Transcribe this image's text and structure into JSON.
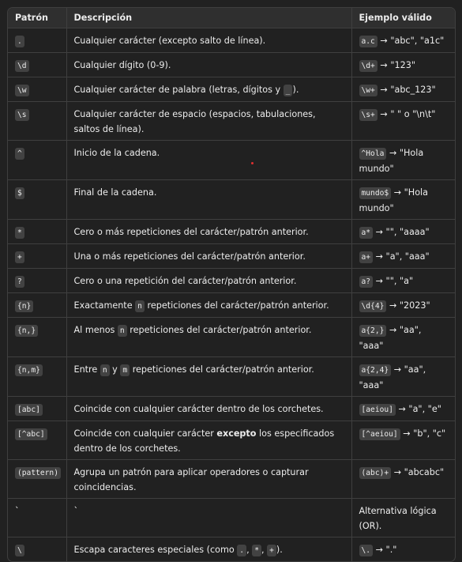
{
  "headers": [
    "Patrón",
    "Descripción",
    "Ejemplo válido"
  ],
  "rows": [
    {
      "pattern": ".",
      "desc": [
        "Cualquier carácter (excepto salto de línea)."
      ],
      "ex_code": "a.c",
      "ex_text": " → \"abc\", \"a1c\""
    },
    {
      "pattern": "\\d",
      "desc": [
        "Cualquier dígito (0-9)."
      ],
      "ex_code": "\\d+",
      "ex_text": " → \"123\""
    },
    {
      "pattern": "\\w",
      "desc": [
        "Cualquier carácter de palabra (letras, dígitos y ",
        {
          "code": "_"
        },
        ")."
      ],
      "ex_code": "\\w+",
      "ex_text": " → \"abc_123\""
    },
    {
      "pattern": "\\s",
      "desc": [
        "Cualquier carácter de espacio (espacios, tabulaciones, saltos de línea)."
      ],
      "ex_code": "\\s+",
      "ex_text": " → \" \" o \"\\n\\t\""
    },
    {
      "pattern": "^",
      "desc": [
        "Inicio de la cadena."
      ],
      "ex_code": "^Hola",
      "ex_text": " → \"Hola mundo\""
    },
    {
      "pattern": "$",
      "desc": [
        "Final de la cadena."
      ],
      "ex_code": "mundo$",
      "ex_text": " → \"Hola mundo\""
    },
    {
      "pattern": "*",
      "desc": [
        "Cero o más repeticiones del carácter/patrón anterior."
      ],
      "ex_code": "a*",
      "ex_text": " → \"\", \"aaaa\""
    },
    {
      "pattern": "+",
      "desc": [
        "Una o más repeticiones del carácter/patrón anterior."
      ],
      "ex_code": "a+",
      "ex_text": " → \"a\", \"aaa\""
    },
    {
      "pattern": "?",
      "desc": [
        "Cero o una repetición del carácter/patrón anterior."
      ],
      "ex_code": "a?",
      "ex_text": " → \"\", \"a\""
    },
    {
      "pattern": "{n}",
      "desc": [
        "Exactamente ",
        {
          "code": "n"
        },
        " repeticiones del carácter/patrón anterior."
      ],
      "ex_code": "\\d{4}",
      "ex_text": " → \"2023\""
    },
    {
      "pattern": "{n,}",
      "desc": [
        "Al menos ",
        {
          "code": "n"
        },
        " repeticiones del carácter/patrón anterior."
      ],
      "ex_code": "a{2,}",
      "ex_text": " → \"aa\", \"aaa\""
    },
    {
      "pattern": "{n,m}",
      "desc": [
        "Entre ",
        {
          "code": "n"
        },
        " y ",
        {
          "code": "m"
        },
        " repeticiones del carácter/patrón anterior."
      ],
      "ex_code": "a{2,4}",
      "ex_text": " → \"aa\", \"aaa\""
    },
    {
      "pattern": "[abc]",
      "desc": [
        "Coincide con cualquier carácter dentro de los corchetes."
      ],
      "ex_code": "[aeiou]",
      "ex_text": " → \"a\", \"e\""
    },
    {
      "pattern": "[^abc]",
      "desc": [
        "Coincide con cualquier carácter ",
        {
          "bold": "excepto"
        },
        " los especificados dentro de los corchetes."
      ],
      "ex_code": "[^aeiou]",
      "ex_text": " → \"b\", \"c\""
    },
    {
      "pattern": "(pattern)",
      "desc": [
        "Agrupa un patrón para aplicar operadores o capturar coincidencias."
      ],
      "ex_code": "(abc)+",
      "ex_text": " → \"abcabc\""
    },
    {
      "pattern_text": "`",
      "desc": [
        "`"
      ],
      "ex_code": "",
      "ex_text": "Alternativa lógica (OR)."
    },
    {
      "pattern": "\\",
      "desc": [
        "Escapa caracteres especiales (como ",
        {
          "code": "."
        },
        ", ",
        {
          "code": "*"
        },
        ", ",
        {
          "code": "+"
        },
        ")."
      ],
      "ex_code": "\\.",
      "ex_text": " → \".\""
    }
  ]
}
